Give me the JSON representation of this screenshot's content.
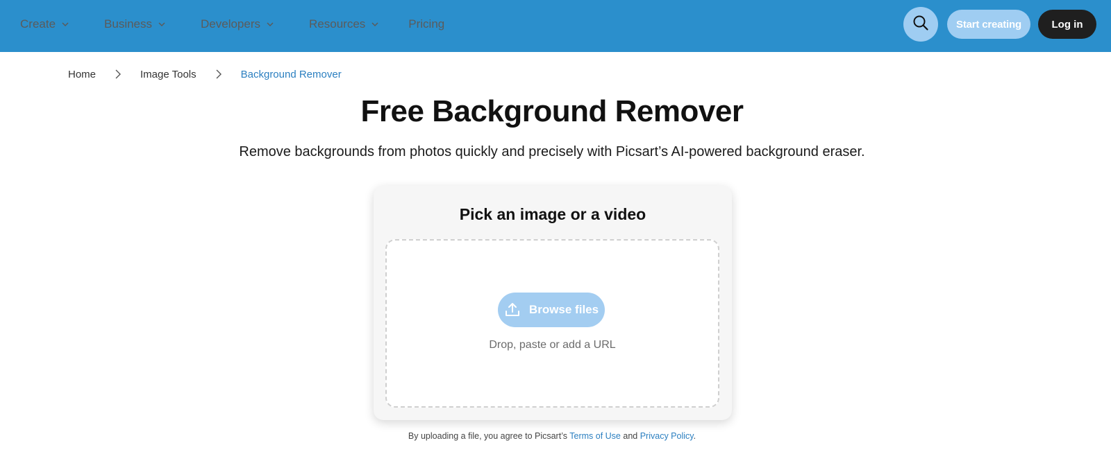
{
  "nav": {
    "items": [
      {
        "label": "Create",
        "has_menu": true
      },
      {
        "label": "Business",
        "has_menu": true
      },
      {
        "label": "Developers",
        "has_menu": true
      },
      {
        "label": "Resources",
        "has_menu": true
      },
      {
        "label": "Pricing",
        "has_menu": false
      }
    ],
    "search_icon": "search-icon",
    "start_label": "Start creating",
    "login_label": "Log in"
  },
  "breadcrumb": {
    "items": [
      "Home",
      "Image Tools",
      "Background Remover"
    ]
  },
  "hero": {
    "title": "Free Background Remover",
    "subtitle": "Remove backgrounds from photos quickly and precisely with Picsart’s AI-powered background eraser."
  },
  "upload": {
    "heading": "Pick an image or a video",
    "browse_label": "Browse files",
    "hint": "Drop, paste or add a URL"
  },
  "legal": {
    "prefix": "By uploading a file, you agree to Picsart’s",
    "terms": "Terms of Use",
    "and": "and",
    "privacy": "Privacy Policy",
    "suffix": "."
  },
  "colors": {
    "header_bg": "#2b8fcc",
    "accent_light": "#9fcdf2",
    "link": "#2b7fc0",
    "dark_button": "#1f1f1f"
  }
}
